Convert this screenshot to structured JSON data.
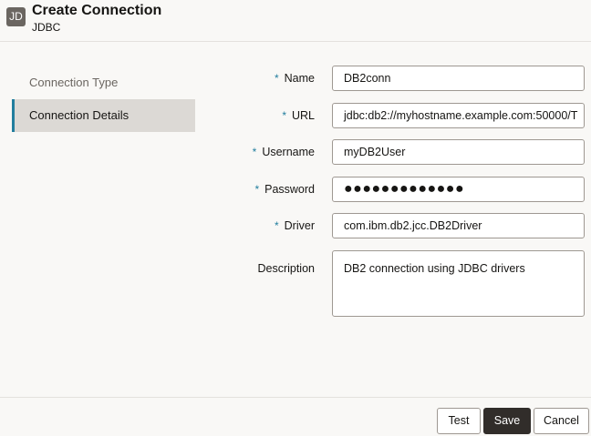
{
  "header": {
    "badge": "JD",
    "title": "Create Connection",
    "subtitle": "JDBC"
  },
  "sidebar": {
    "items": [
      {
        "label": "Connection Type",
        "active": false
      },
      {
        "label": "Connection Details",
        "active": true
      }
    ]
  },
  "form": {
    "required_marker": "*",
    "name": {
      "label": "Name",
      "value": "DB2conn",
      "required": true
    },
    "url": {
      "label": "URL",
      "value": "jdbc:db2://myhostname.example.com:50000/T",
      "required": true
    },
    "username": {
      "label": "Username",
      "value": "myDB2User",
      "required": true
    },
    "password": {
      "label": "Password",
      "value": "●●●●●●●●●●●●●",
      "required": true
    },
    "driver": {
      "label": "Driver",
      "value": "com.ibm.db2.jcc.DB2Driver",
      "required": true
    },
    "description": {
      "label": "Description",
      "value": "DB2 connection using JDBC drivers",
      "required": false
    }
  },
  "footer": {
    "test_label": "Test",
    "save_label": "Save",
    "cancel_label": "Cancel"
  },
  "colors": {
    "accent": "#227e9e",
    "primary_button": "#312d2a",
    "badge": "#6b6661"
  }
}
